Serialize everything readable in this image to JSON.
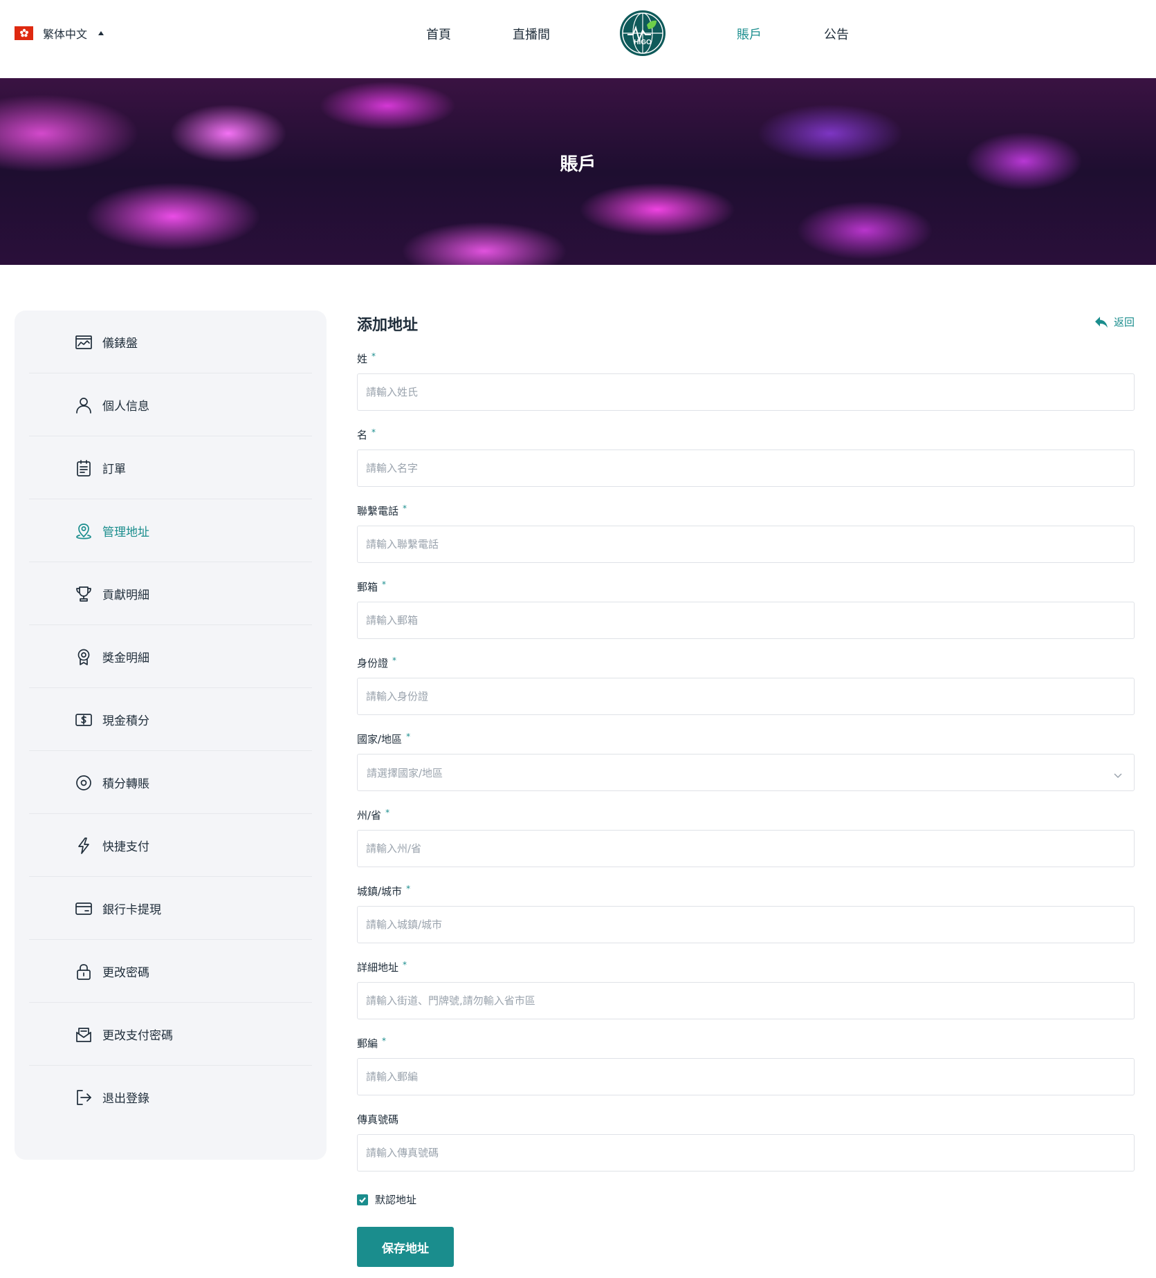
{
  "header": {
    "language": "繁体中文",
    "nav": [
      {
        "label": "首頁",
        "active": false
      },
      {
        "label": "直播間",
        "active": false
      },
      {
        "label": "賬戶",
        "active": true
      },
      {
        "label": "公告",
        "active": false
      }
    ],
    "logo_text": "HIGO"
  },
  "banner": {
    "title": "賬戶"
  },
  "sidebar": {
    "items": [
      {
        "label": "儀錶盤",
        "icon": "dashboard-icon"
      },
      {
        "label": "個人信息",
        "icon": "user-icon"
      },
      {
        "label": "訂單",
        "icon": "clipboard-icon"
      },
      {
        "label": "管理地址",
        "icon": "location-pin-icon",
        "active": true
      },
      {
        "label": "貢獻明細",
        "icon": "trophy-icon"
      },
      {
        "label": "獎金明細",
        "icon": "medal-icon"
      },
      {
        "label": "現金積分",
        "icon": "dollar-icon"
      },
      {
        "label": "積分轉賬",
        "icon": "coin-icon"
      },
      {
        "label": "快捷支付",
        "icon": "lightning-icon"
      },
      {
        "label": "銀行卡提現",
        "icon": "card-icon"
      },
      {
        "label": "更改密碼",
        "icon": "lock-icon"
      },
      {
        "label": "更改支付密碼",
        "icon": "envelope-icon"
      },
      {
        "label": "退出登錄",
        "icon": "logout-icon"
      }
    ]
  },
  "form": {
    "title": "添加地址",
    "back_label": "返回",
    "required_mark": "*",
    "fields": {
      "surname": {
        "label": "姓",
        "placeholder": "請輸入姓氏",
        "value": ""
      },
      "given_name": {
        "label": "名",
        "placeholder": "請輸入名字",
        "value": ""
      },
      "phone": {
        "label": "聯繫電話",
        "placeholder": "請輸入聯繫電話",
        "value": ""
      },
      "email": {
        "label": "郵箱",
        "placeholder": "請輸入郵箱",
        "value": ""
      },
      "id_card": {
        "label": "身份證",
        "placeholder": "請輸入身份證",
        "value": ""
      },
      "country": {
        "label": "國家/地區",
        "placeholder": "請選擇國家/地區"
      },
      "state": {
        "label": "州/省",
        "placeholder": "請輸入州/省",
        "value": ""
      },
      "city": {
        "label": "城鎮/城市",
        "placeholder": "請輸入城鎮/城市",
        "value": ""
      },
      "address": {
        "label": "詳細地址",
        "placeholder": "請輸入街道、門牌號,請勿輸入省市區",
        "value": ""
      },
      "postcode": {
        "label": "郵編",
        "placeholder": "請輸入郵編",
        "value": ""
      },
      "fax": {
        "label": "傳真號碼",
        "placeholder": "請輸入傳真號碼",
        "value": ""
      }
    },
    "default_address": {
      "label": "默認地址",
      "checked": true
    },
    "save_label": "保存地址"
  },
  "colors": {
    "accent": "#1a8d8d",
    "text": "#1f2d3a",
    "sidebar_bg": "#f4f5f8"
  }
}
